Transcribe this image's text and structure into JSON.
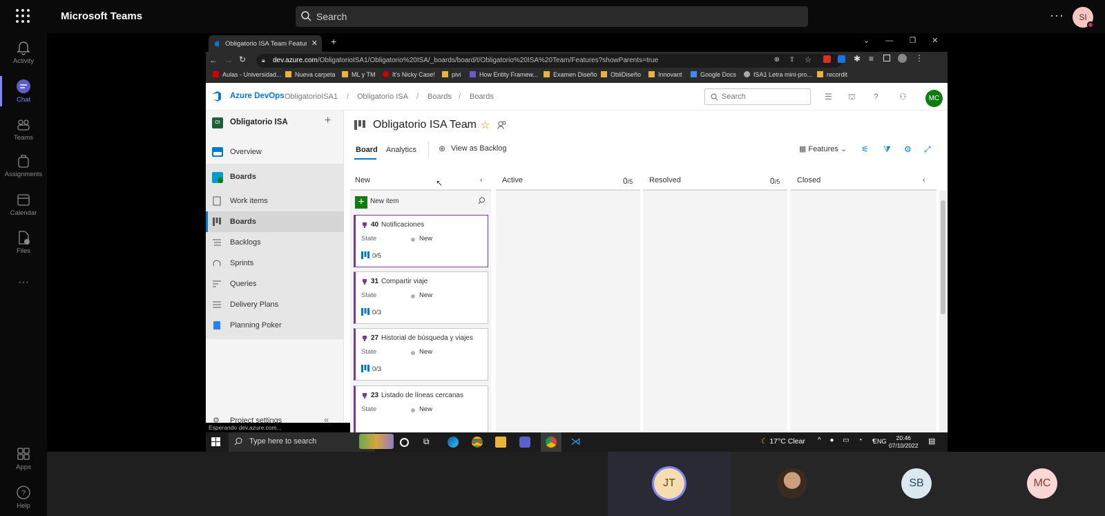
{
  "teams": {
    "app_title": "Microsoft Teams",
    "search_placeholder": "Search",
    "user_initials": "SI",
    "rail": [
      {
        "label": "Activity"
      },
      {
        "label": "Chat"
      },
      {
        "label": "Teams"
      },
      {
        "label": "Assignments"
      },
      {
        "label": "Calendar"
      },
      {
        "label": "Files"
      },
      {
        "label": "Apps"
      },
      {
        "label": "Help"
      }
    ]
  },
  "browser": {
    "tab_title": "Obligatorio ISA Team Features B...",
    "url_host": "dev.azure.com",
    "url_path": "/ObligatorioISA1/Obligatorio%20ISA/_boards/board/t/Obligatorio%20ISA%20Team/Features?showParents=true",
    "bookmarks": [
      "Aulas - Universidad...",
      "Nueva carpeta",
      "ML y TM",
      "It's Nicky Case!",
      "pivi",
      "How Entity Framew...",
      "Examen Diseño",
      "ObliDiseño",
      "Innovant",
      "Google Docs",
      "ISA1 Letra mini-pro...",
      "recordit"
    ],
    "status": "Esperando dev.azure.com..."
  },
  "ado": {
    "brand": "Azure DevOps",
    "breadcrumb": [
      "ObligatorioISA1",
      "Obligatorio ISA",
      "Boards",
      "Boards"
    ],
    "search_placeholder": "Search",
    "user_initials": "MC",
    "project_initials": "OI",
    "project_name": "Obligatorio ISA",
    "nav": [
      "Overview",
      "Boards",
      "Work items",
      "Boards",
      "Backlogs",
      "Sprints",
      "Queries",
      "Delivery Plans",
      "Planning Poker"
    ],
    "project_settings": "Project settings",
    "team_title": "Obligatorio ISA Team",
    "tabs": [
      "Board",
      "Analytics"
    ],
    "view_as_backlog": "View as Backlog",
    "level_selector": "Features",
    "columns": [
      {
        "name": "New",
        "count": ""
      },
      {
        "name": "Active",
        "count": "0",
        "limit": "/5"
      },
      {
        "name": "Resolved",
        "count": "0",
        "limit": "/5"
      },
      {
        "name": "Closed",
        "count": ""
      }
    ],
    "new_item": "New item",
    "cards": [
      {
        "id": "40",
        "title": "Notificaciones",
        "state_label": "State",
        "state": "New",
        "progress": "0/5"
      },
      {
        "id": "31",
        "title": "Compartir viaje",
        "state_label": "State",
        "state": "New",
        "progress": "0/3"
      },
      {
        "id": "27",
        "title": "Historial de búsqueda y viajes",
        "state_label": "State",
        "state": "New",
        "progress": "0/3"
      },
      {
        "id": "23",
        "title": "Listado de líneas cercanas",
        "state_label": "State",
        "state": "New",
        "progress": ""
      }
    ]
  },
  "taskbar": {
    "search_placeholder": "Type here to search",
    "weather": "17°C  Clear",
    "lang": "ENG",
    "time": "20:46",
    "date": "07/10/2022"
  },
  "participants": [
    {
      "initials": "JT"
    },
    {
      "initials": ""
    },
    {
      "initials": "SB"
    },
    {
      "initials": "MC"
    }
  ],
  "colors": {
    "teams_accent": "#7f85f5",
    "ado_blue": "#0078d4",
    "feature_purple": "#773b93",
    "new_item_green": "#107c10"
  }
}
